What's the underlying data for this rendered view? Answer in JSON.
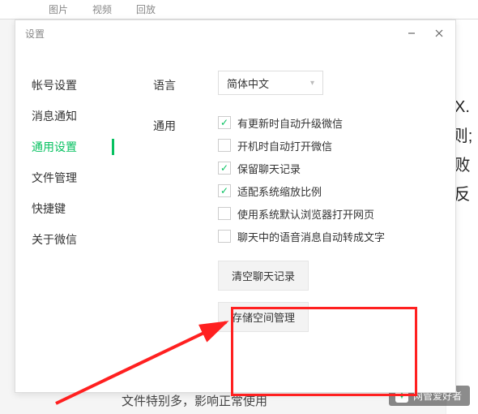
{
  "bg_toolbar": [
    "图片",
    "视频",
    "回放",
    "...",
    "..."
  ],
  "bg_right": "X. 则; 败反",
  "bg_bottom": "文件特别多，影响正常使用",
  "watermark": "网管爱好者",
  "dialog": {
    "title": "设置",
    "sidebar": {
      "items": [
        {
          "label": "帐号设置",
          "key": "account"
        },
        {
          "label": "消息通知",
          "key": "notify"
        },
        {
          "label": "通用设置",
          "key": "general",
          "active": true
        },
        {
          "label": "文件管理",
          "key": "files"
        },
        {
          "label": "快捷键",
          "key": "shortcuts"
        },
        {
          "label": "关于微信",
          "key": "about"
        }
      ]
    },
    "labels": {
      "language": "语言",
      "general": "通用"
    },
    "language_select": {
      "value": "简体中文"
    },
    "options": [
      {
        "label": "有更新时自动升级微信",
        "checked": true
      },
      {
        "label": "开机时自动打开微信",
        "checked": false
      },
      {
        "label": "保留聊天记录",
        "checked": true
      },
      {
        "label": "适配系统缩放比例",
        "checked": true
      },
      {
        "label": "使用系统默认浏览器打开网页",
        "checked": false
      },
      {
        "label": "聊天中的语音消息自动转成文字",
        "checked": false
      }
    ],
    "buttons": {
      "clear_history": "清空聊天记录",
      "storage_mgmt": "存储空间管理"
    }
  }
}
